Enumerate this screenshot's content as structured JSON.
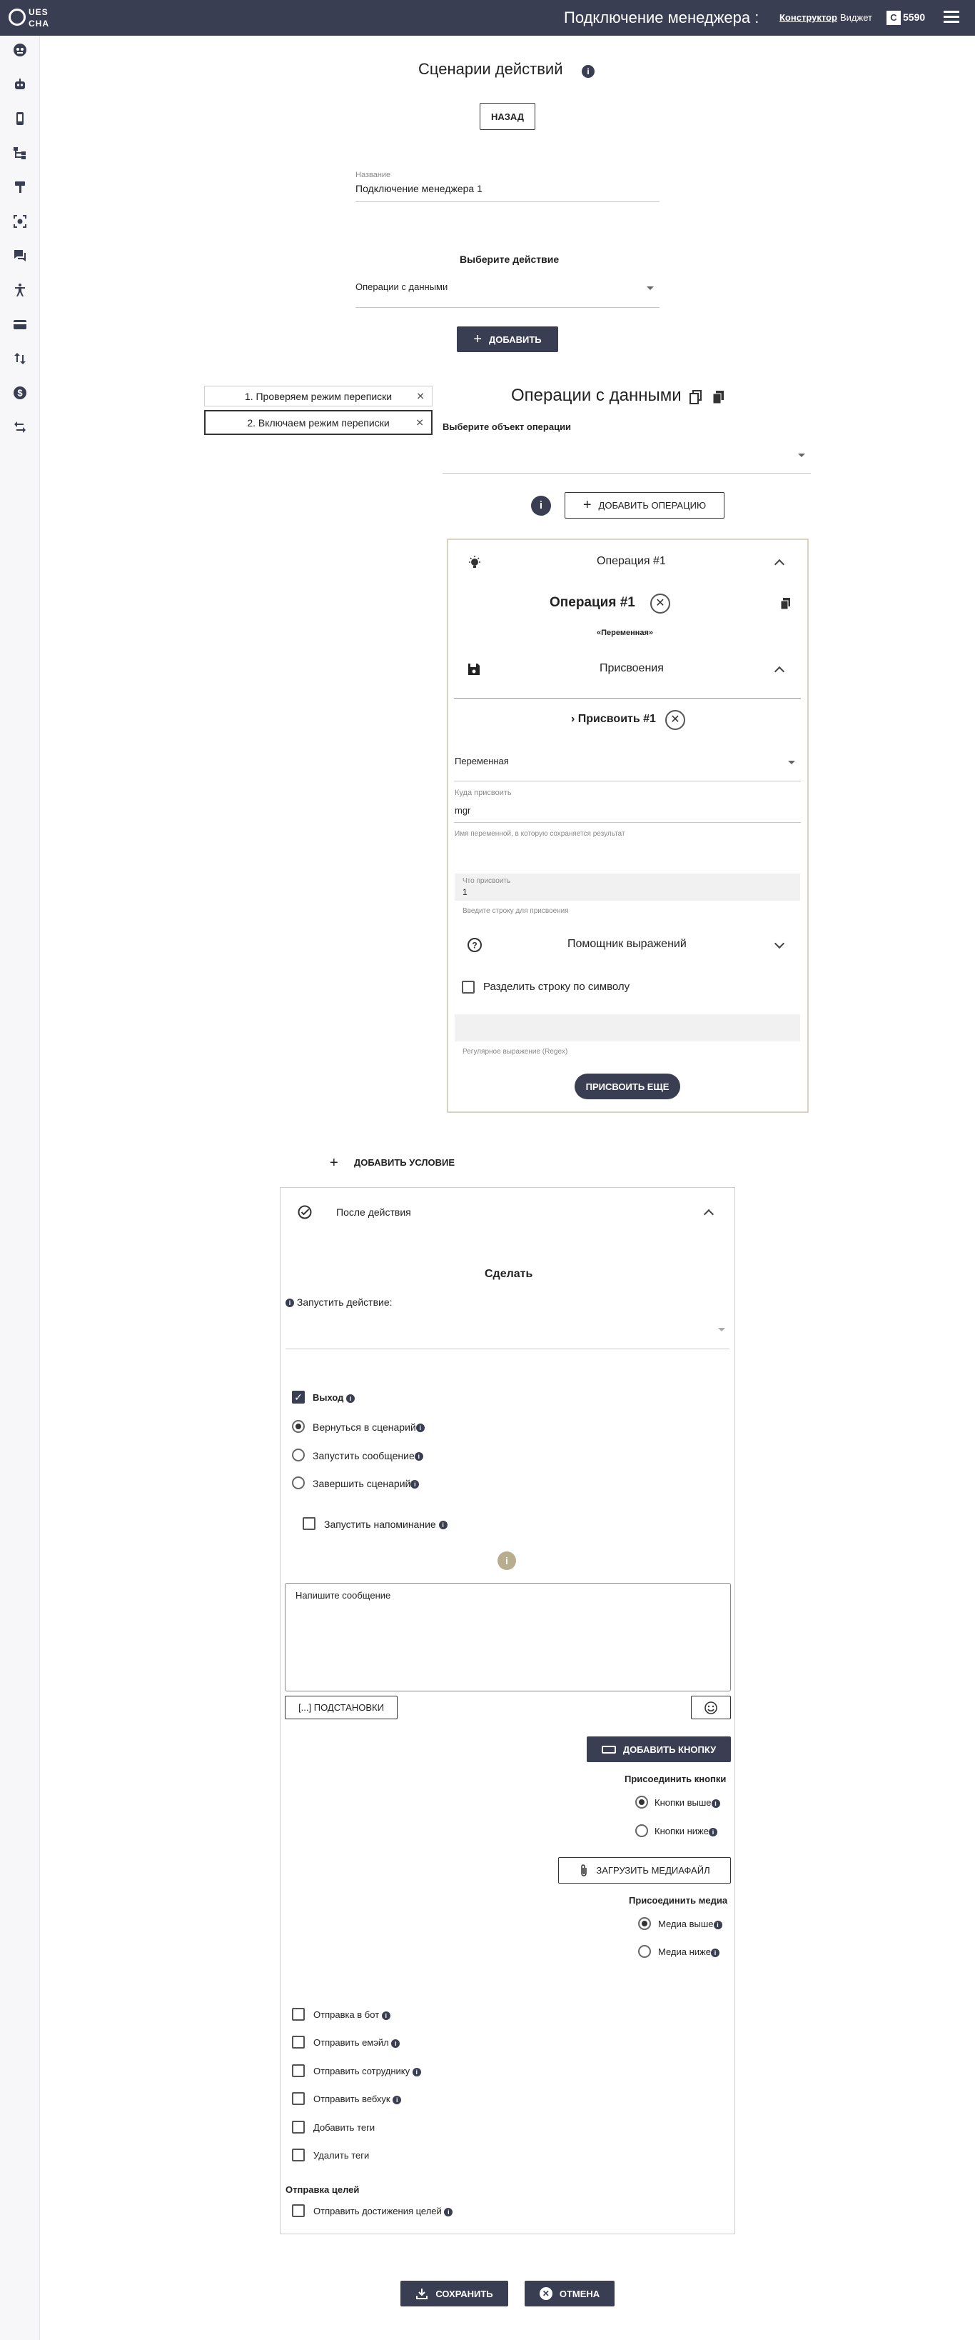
{
  "topbar": {
    "logo_line1": "UES",
    "logo_line2": "CHA",
    "title": "Подключение менеджера :",
    "nav_constructor": "Конструктор",
    "nav_widget": "Виджет",
    "balance_icon": "C",
    "balance": "5590"
  },
  "sidebar": {
    "items": [
      "robot-face-icon",
      "bot-icon",
      "phone-icon",
      "tree-icon",
      "brush-icon",
      "scan-icon",
      "chat-icon",
      "accessibility-icon",
      "card-icon",
      "swap-vert-icon",
      "dollar-icon",
      "swap-horiz-icon"
    ]
  },
  "page": {
    "title": "Сценарии действий",
    "back_button": "НАЗАД",
    "name_label": "Название",
    "name_value": "Подключение менеджера 1",
    "choose_action_label": "Выберите действие",
    "action_value": "Операции с данными",
    "add_button": "ДОБАВИТЬ"
  },
  "steps": [
    {
      "label": "1. Проверяем режим переписки",
      "active": false
    },
    {
      "label": "2. Включаем режим переписки",
      "active": true
    }
  ],
  "operations": {
    "title": "Операции с данными",
    "object_label": "Выберите объект операции",
    "add_operation_button": "ДОБАВИТЬ ОПЕРАЦИЮ",
    "panel_title": "Операция #1",
    "op_name": "Операция #1",
    "op_type": "«Переменная»",
    "assign_section": "Присвоения",
    "assign_name": "Присвоить #1",
    "assign_bullet": "›",
    "variable_select": "Переменная",
    "where_label": "Куда присвоить",
    "where_value": "mgr",
    "where_hint": "Имя переменной, в которую сохраняется результат",
    "what_label": "Что присвоить",
    "what_value": "1",
    "what_hint": "Введите строку для присвоения",
    "expr_helper": "Помощник выражений",
    "split_label": "Разделить строку по символу",
    "regex_hint": "Регулярное выражение (Regex)",
    "assign_more_button": "ПРИСВОИТЬ ЕЩЕ"
  },
  "conditions": {
    "add_condition": "ДОБАВИТЬ УСЛОВИЕ"
  },
  "after": {
    "title": "После действия",
    "do_label": "Сделать",
    "run_action_label": "Запустить действие:",
    "exit_label": "Выход",
    "radio_options": [
      {
        "label": "Вернуться в сценарий",
        "selected": true
      },
      {
        "label": "Запустить сообщение",
        "selected": false
      },
      {
        "label": "Завершить сценарий",
        "selected": false
      }
    ],
    "reminder_label": "Запустить напоминание",
    "message_placeholder": "Напишите сообщение",
    "substitutions_button": "[...] ПОДСТАНОВКИ",
    "add_button_button": "ДОБАВИТЬ КНОПКУ",
    "attach_buttons_label": "Присоединить кнопки",
    "buttons_above": "Кнопки выше",
    "buttons_below": "Кнопки ниже",
    "upload_media_button": "ЗАГРУЗИТЬ МЕДИАФАЙЛ",
    "attach_media_label": "Присоединить медиа",
    "media_above": "Медиа выше",
    "media_below": "Медиа ниже",
    "checkbox_options": [
      {
        "label": "Отправка в бот",
        "info": true
      },
      {
        "label": "Отправить емэйл",
        "info": true
      },
      {
        "label": "Отправить сотруднику",
        "info": true
      },
      {
        "label": "Отправить вебхук",
        "info": true
      },
      {
        "label": "Добавить теги",
        "info": false
      },
      {
        "label": "Удалить теги",
        "info": false
      }
    ],
    "goals_label": "Отправка целей",
    "goals_checkbox": "Отправить достижения целей"
  },
  "footer": {
    "save_button": "СОХРАНИТЬ",
    "cancel_button": "ОТМЕНА"
  },
  "colors": {
    "primary": "#3a3e52",
    "panel_border": "#d8d4c0"
  }
}
